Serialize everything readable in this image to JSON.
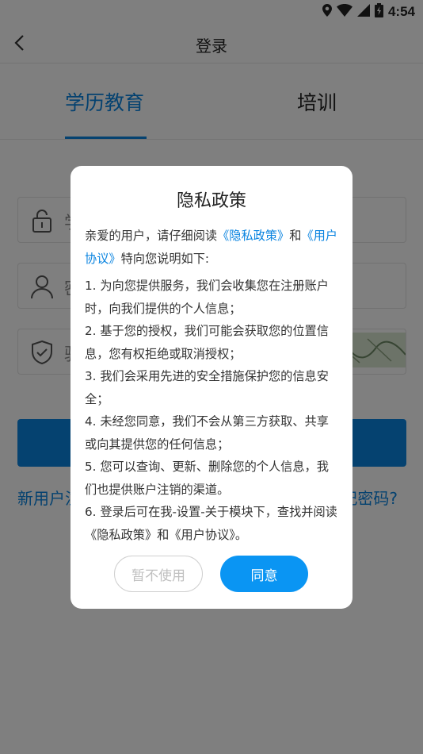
{
  "status_bar": {
    "time": "4:54"
  },
  "nav": {
    "title": "登录"
  },
  "tabs": [
    {
      "label": "学历教育"
    },
    {
      "label": "培训"
    }
  ],
  "form": {
    "field1_peek": "学",
    "field2_peek": "密",
    "field3_peek": "验",
    "link_left": "新用户注",
    "link_right": "记密码?"
  },
  "dialog": {
    "title": "隐私政策",
    "intro_prefix": "亲爱的用户，请仔细阅读",
    "privacy_link": "《隐私政策》",
    "intro_and": "和",
    "agreement_link": "《用户协议》",
    "intro_suffix": "特向您说明如下:",
    "items": [
      "1. 为向您提供服务，我们会收集您在注册账户时，向我们提供的个人信息；",
      "2. 基于您的授权，我们可能会获取您的位置信息，您有权拒绝或取消授权；",
      "3. 我们会采用先进的安全措施保护您的信息安全；",
      "4. 未经您同意，我们不会从第三方获取、共享或向其提供您的任何信息；",
      "5. 您可以查询、更新、删除您的个人信息，我们也提供账户注销的渠道。",
      "6. 登录后可在我-设置-关于模块下，查找并阅读《隐私政策》和《用户协议》。"
    ],
    "decline_label": "暂不使用",
    "agree_label": "同意"
  },
  "colors": {
    "accent": "#0a84e0",
    "agree_button": "#0a95f3",
    "overlay": "rgba(0,0,0,0.5)"
  }
}
